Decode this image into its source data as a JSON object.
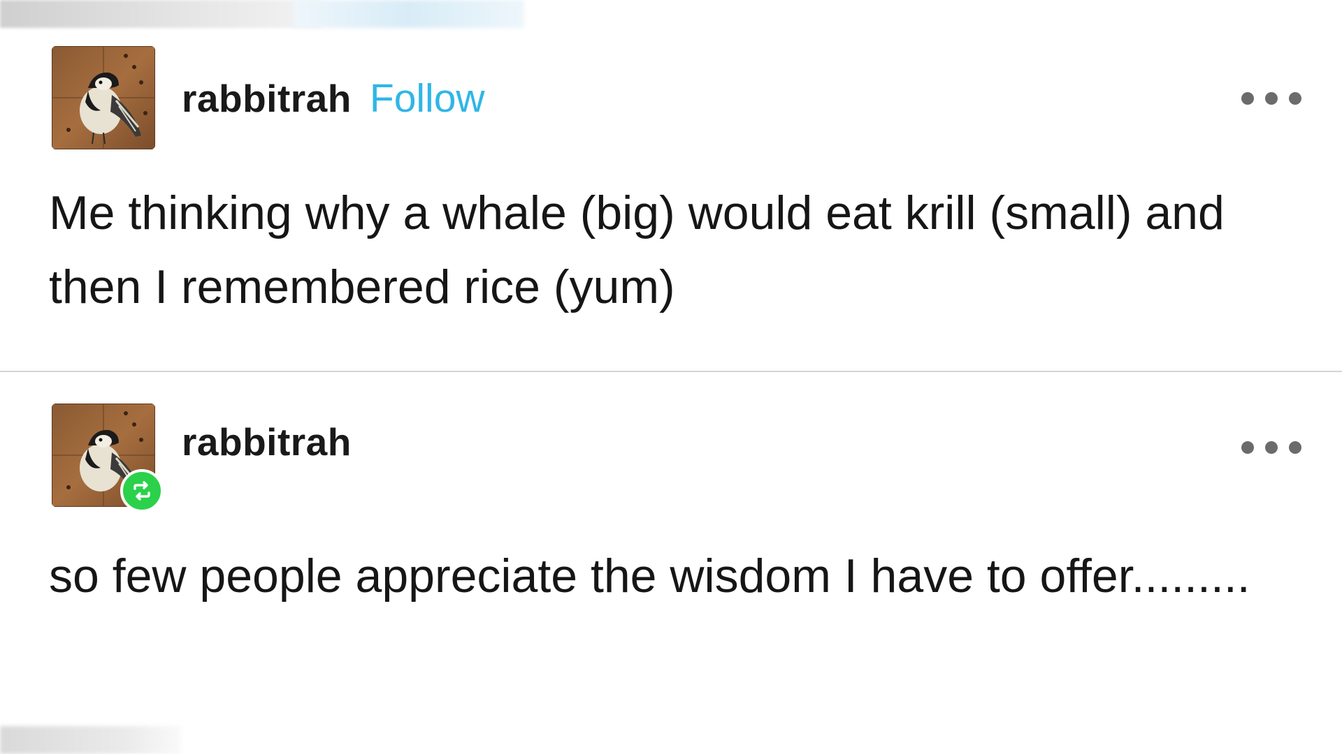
{
  "posts": [
    {
      "username": "rabbitrah",
      "follow_label": "Follow",
      "text": "Me thinking why a whale (big) would eat krill (small) and then I remembered rice (yum)",
      "avatar_icon": "bird-avatar-icon",
      "more_icon": "more-options-icon"
    },
    {
      "username": "rabbitrah",
      "text": "so few people appreciate the wisdom I have to offer.........",
      "avatar_icon": "bird-avatar-icon",
      "badge_icon": "reblog-icon",
      "more_icon": "more-options-icon"
    }
  ],
  "colors": {
    "follow": "#2fb6e6",
    "reblog_badge": "#2bd14a",
    "divider": "#d4d4d4",
    "dots": "#6b6b6b"
  }
}
